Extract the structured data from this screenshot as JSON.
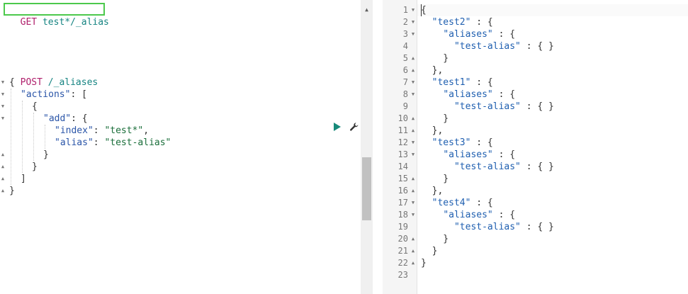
{
  "request_editor": {
    "get_method": "GET",
    "get_path": "test*/_alias",
    "post_method": "POST",
    "post_path": "/_aliases",
    "body": {
      "open_brace": "{",
      "actions_key": "\"actions\"",
      "colon_bracket": ": [",
      "open_obj": "{",
      "add_key": "\"add\"",
      "colon_brace": ": {",
      "index_key": "\"index\"",
      "index_sep": ": ",
      "index_value": "\"test*\"",
      "comma": ",",
      "alias_key": "\"alias\"",
      "alias_sep": ": ",
      "alias_value": "\"test-alias\"",
      "close_inner": "}",
      "close_obj": "}",
      "close_bracket": "]",
      "close_brace": "}"
    },
    "run_icon": "play-icon",
    "settings_icon": "wrench-icon"
  },
  "response_viewer": {
    "line_numbers": [
      "1",
      "2",
      "3",
      "4",
      "5",
      "6",
      "7",
      "8",
      "9",
      "10",
      "11",
      "12",
      "13",
      "14",
      "15",
      "16",
      "17",
      "18",
      "19",
      "20",
      "21",
      "22",
      "23"
    ],
    "lines": [
      "{",
      "  \"test2\" : {",
      "    \"aliases\" : {",
      "      \"test-alias\" : { }",
      "    }",
      "  },",
      "  \"test1\" : {",
      "    \"aliases\" : {",
      "      \"test-alias\" : { }",
      "    }",
      "  },",
      "  \"test3\" : {",
      "    \"aliases\" : {",
      "      \"test-alias\" : { }",
      "    }",
      "  },",
      "  \"test4\" : {",
      "    \"aliases\" : {",
      "      \"test-alias\" : { }",
      "    }",
      "  }",
      "}",
      ""
    ],
    "folds": [
      "down",
      "down",
      "down",
      "",
      "up",
      "up",
      "down",
      "down",
      "",
      "up",
      "up",
      "down",
      "down",
      "",
      "up",
      "up",
      "down",
      "down",
      "",
      "up",
      "up",
      "up",
      ""
    ]
  },
  "colors": {
    "method": "#b0206c",
    "path": "#168482",
    "string": "#1a6e3a",
    "key": "#2a55a8",
    "highlight_border": "#4cc94c",
    "run": "#178a7a"
  }
}
